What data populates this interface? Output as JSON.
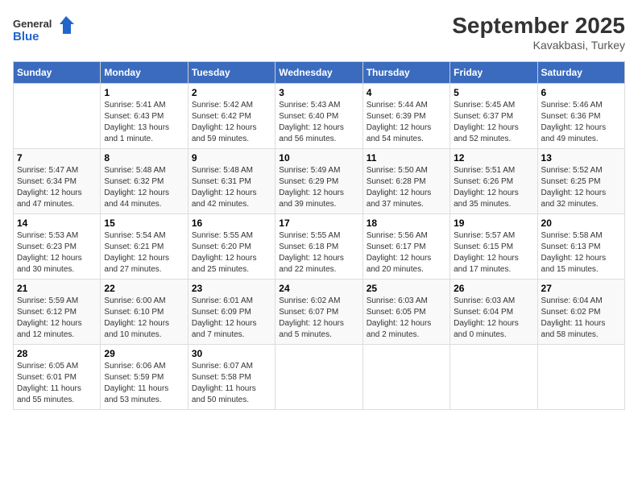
{
  "header": {
    "logo_line1": "General",
    "logo_line2": "Blue",
    "month": "September 2025",
    "location": "Kavakbasi, Turkey"
  },
  "weekdays": [
    "Sunday",
    "Monday",
    "Tuesday",
    "Wednesday",
    "Thursday",
    "Friday",
    "Saturday"
  ],
  "weeks": [
    [
      {
        "day": "",
        "info": ""
      },
      {
        "day": "1",
        "info": "Sunrise: 5:41 AM\nSunset: 6:43 PM\nDaylight: 13 hours\nand 1 minute."
      },
      {
        "day": "2",
        "info": "Sunrise: 5:42 AM\nSunset: 6:42 PM\nDaylight: 12 hours\nand 59 minutes."
      },
      {
        "day": "3",
        "info": "Sunrise: 5:43 AM\nSunset: 6:40 PM\nDaylight: 12 hours\nand 56 minutes."
      },
      {
        "day": "4",
        "info": "Sunrise: 5:44 AM\nSunset: 6:39 PM\nDaylight: 12 hours\nand 54 minutes."
      },
      {
        "day": "5",
        "info": "Sunrise: 5:45 AM\nSunset: 6:37 PM\nDaylight: 12 hours\nand 52 minutes."
      },
      {
        "day": "6",
        "info": "Sunrise: 5:46 AM\nSunset: 6:36 PM\nDaylight: 12 hours\nand 49 minutes."
      }
    ],
    [
      {
        "day": "7",
        "info": "Sunrise: 5:47 AM\nSunset: 6:34 PM\nDaylight: 12 hours\nand 47 minutes."
      },
      {
        "day": "8",
        "info": "Sunrise: 5:48 AM\nSunset: 6:32 PM\nDaylight: 12 hours\nand 44 minutes."
      },
      {
        "day": "9",
        "info": "Sunrise: 5:48 AM\nSunset: 6:31 PM\nDaylight: 12 hours\nand 42 minutes."
      },
      {
        "day": "10",
        "info": "Sunrise: 5:49 AM\nSunset: 6:29 PM\nDaylight: 12 hours\nand 39 minutes."
      },
      {
        "day": "11",
        "info": "Sunrise: 5:50 AM\nSunset: 6:28 PM\nDaylight: 12 hours\nand 37 minutes."
      },
      {
        "day": "12",
        "info": "Sunrise: 5:51 AM\nSunset: 6:26 PM\nDaylight: 12 hours\nand 35 minutes."
      },
      {
        "day": "13",
        "info": "Sunrise: 5:52 AM\nSunset: 6:25 PM\nDaylight: 12 hours\nand 32 minutes."
      }
    ],
    [
      {
        "day": "14",
        "info": "Sunrise: 5:53 AM\nSunset: 6:23 PM\nDaylight: 12 hours\nand 30 minutes."
      },
      {
        "day": "15",
        "info": "Sunrise: 5:54 AM\nSunset: 6:21 PM\nDaylight: 12 hours\nand 27 minutes."
      },
      {
        "day": "16",
        "info": "Sunrise: 5:55 AM\nSunset: 6:20 PM\nDaylight: 12 hours\nand 25 minutes."
      },
      {
        "day": "17",
        "info": "Sunrise: 5:55 AM\nSunset: 6:18 PM\nDaylight: 12 hours\nand 22 minutes."
      },
      {
        "day": "18",
        "info": "Sunrise: 5:56 AM\nSunset: 6:17 PM\nDaylight: 12 hours\nand 20 minutes."
      },
      {
        "day": "19",
        "info": "Sunrise: 5:57 AM\nSunset: 6:15 PM\nDaylight: 12 hours\nand 17 minutes."
      },
      {
        "day": "20",
        "info": "Sunrise: 5:58 AM\nSunset: 6:13 PM\nDaylight: 12 hours\nand 15 minutes."
      }
    ],
    [
      {
        "day": "21",
        "info": "Sunrise: 5:59 AM\nSunset: 6:12 PM\nDaylight: 12 hours\nand 12 minutes."
      },
      {
        "day": "22",
        "info": "Sunrise: 6:00 AM\nSunset: 6:10 PM\nDaylight: 12 hours\nand 10 minutes."
      },
      {
        "day": "23",
        "info": "Sunrise: 6:01 AM\nSunset: 6:09 PM\nDaylight: 12 hours\nand 7 minutes."
      },
      {
        "day": "24",
        "info": "Sunrise: 6:02 AM\nSunset: 6:07 PM\nDaylight: 12 hours\nand 5 minutes."
      },
      {
        "day": "25",
        "info": "Sunrise: 6:03 AM\nSunset: 6:05 PM\nDaylight: 12 hours\nand 2 minutes."
      },
      {
        "day": "26",
        "info": "Sunrise: 6:03 AM\nSunset: 6:04 PM\nDaylight: 12 hours\nand 0 minutes."
      },
      {
        "day": "27",
        "info": "Sunrise: 6:04 AM\nSunset: 6:02 PM\nDaylight: 11 hours\nand 58 minutes."
      }
    ],
    [
      {
        "day": "28",
        "info": "Sunrise: 6:05 AM\nSunset: 6:01 PM\nDaylight: 11 hours\nand 55 minutes."
      },
      {
        "day": "29",
        "info": "Sunrise: 6:06 AM\nSunset: 5:59 PM\nDaylight: 11 hours\nand 53 minutes."
      },
      {
        "day": "30",
        "info": "Sunrise: 6:07 AM\nSunset: 5:58 PM\nDaylight: 11 hours\nand 50 minutes."
      },
      {
        "day": "",
        "info": ""
      },
      {
        "day": "",
        "info": ""
      },
      {
        "day": "",
        "info": ""
      },
      {
        "day": "",
        "info": ""
      }
    ]
  ]
}
